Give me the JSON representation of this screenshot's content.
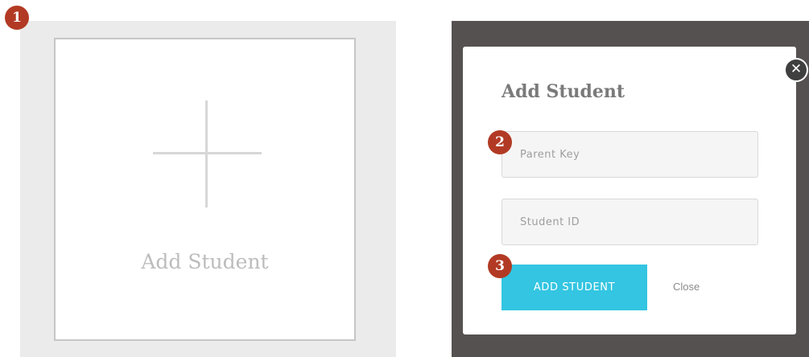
{
  "left": {
    "card_label": "Add Student",
    "step_badge": "1"
  },
  "modal": {
    "title": "Add Student",
    "close_icon": "✕",
    "parent_key_placeholder": "Parent Key",
    "student_id_placeholder": "Student ID",
    "submit_label": "ADD STUDENT",
    "close_link": "Close",
    "badge_2": "2",
    "badge_3": "3"
  },
  "colors": {
    "accent": "#33c5e1",
    "badge": "#b23a24",
    "overlay": "#565151"
  }
}
